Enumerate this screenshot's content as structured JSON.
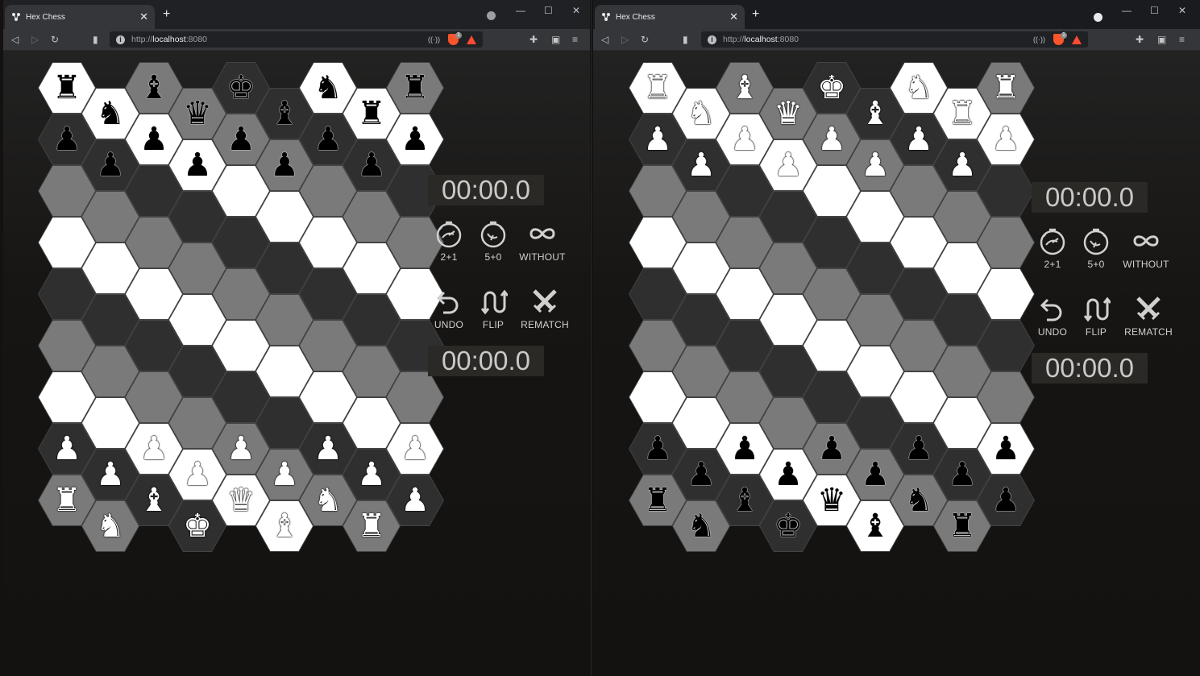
{
  "windows": [
    {
      "tab_title": "Hex Chess",
      "url_scheme": "http://",
      "url_host": "localhost",
      "url_port": ":8080",
      "clock_top": "00:00.0",
      "clock_bottom": "00:00.0",
      "time_controls": [
        "2+1",
        "5+0",
        "WITHOUT"
      ],
      "actions": [
        "UNDO",
        "FLIP",
        "REMATCH"
      ],
      "board": {
        "columns": 9,
        "rows": 10,
        "top_side": "black",
        "top_back": [
          "rook",
          "knight",
          "bishop",
          "queen",
          "king",
          "bishop",
          "knight",
          "rook"
        ],
        "pieces_note_cols": [
          0,
          1,
          2,
          3,
          4,
          5,
          6,
          7,
          8
        ]
      }
    },
    {
      "tab_title": "Hex Chess",
      "url_scheme": "http://",
      "url_host": "localhost",
      "url_port": ":8080",
      "clock_top": "00:00.0",
      "clock_bottom": "00:00.0",
      "time_controls": [
        "2+1",
        "5+0",
        "WITHOUT"
      ],
      "actions": [
        "UNDO",
        "FLIP",
        "REMATCH"
      ],
      "board": {
        "columns": 9,
        "rows": 10,
        "top_side": "white"
      }
    }
  ],
  "colors": {
    "light": "#ffffff",
    "mid": "#7a7a7a",
    "dark": "#2f2f2f",
    "clock_bg": "#2a2926"
  },
  "icons": [
    "hex-chess-logo-icon",
    "back-icon",
    "forward-icon",
    "reload-icon",
    "bookmark-icon",
    "info-icon",
    "cast-icon",
    "brave-shield-icon",
    "brave-rewards-icon",
    "extensions-icon",
    "wallet-icon",
    "menu-icon",
    "stopwatch-icon",
    "stopwatch-icon",
    "infinity-icon",
    "undo-icon",
    "flip-icon",
    "crossed-swords-icon"
  ]
}
